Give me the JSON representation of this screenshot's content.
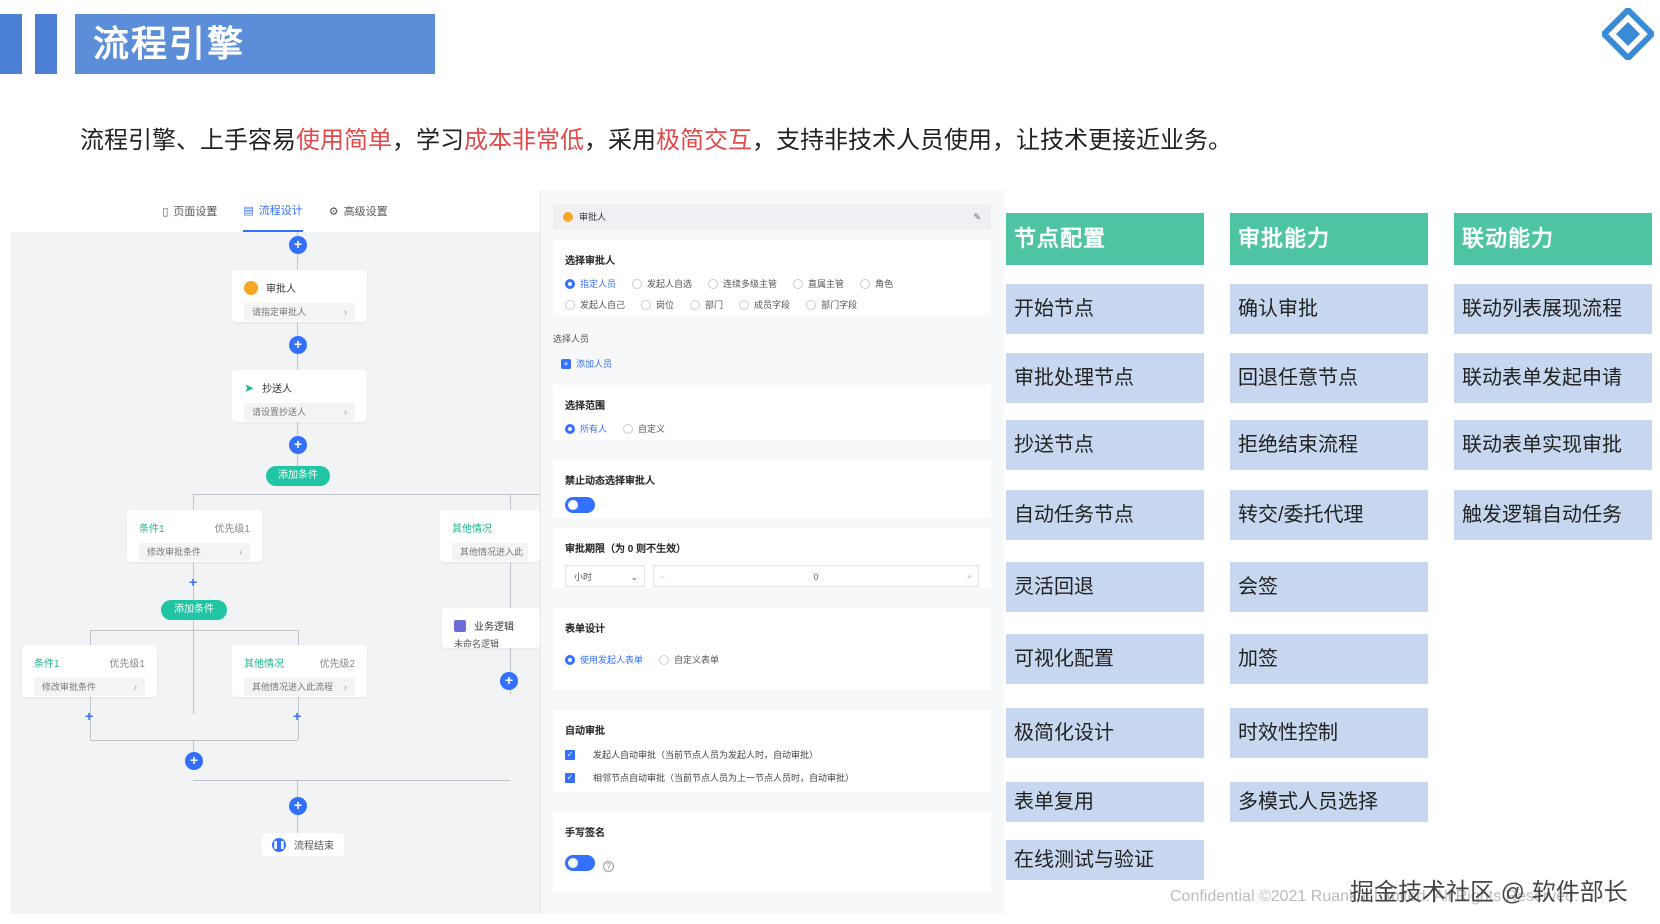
{
  "header": {
    "title": "流程引擎"
  },
  "subtitle": {
    "p1": "流程引擎、上手容易",
    "h1": "使用简单",
    "p2": "，学习",
    "h2": "成本非常低",
    "p3": "，采用",
    "h3": "极简交互",
    "p4": "，支持非技术人员使用，让技术更接近业务。"
  },
  "flow": {
    "tabs": [
      "页面设置",
      "流程设计",
      "高级设置"
    ],
    "approver": {
      "title": "审批人",
      "body": "请指定审批人"
    },
    "cc": {
      "title": "抄送人",
      "body": "请设置抄送人"
    },
    "add_condition": "添加条件",
    "cond1": {
      "name": "条件1",
      "priority": "优先级1",
      "body": "修改审批条件"
    },
    "other1": {
      "name": "其他情况",
      "body": "其他情况进入此"
    },
    "cond_a": {
      "name": "条件1",
      "priority": "优先级1",
      "body": "修改审批条件"
    },
    "other2": {
      "name": "其他情况",
      "priority": "优先级2",
      "body": "其他情况进入此流程"
    },
    "biz": {
      "title": "业务逻辑",
      "body": "未命名逻辑"
    },
    "end": "流程结束"
  },
  "config": {
    "top_title": "审批人",
    "select_approver": {
      "title": "选择审批人",
      "options": [
        "指定人员",
        "发起人自选",
        "连续多级主管",
        "直属主管",
        "角色",
        "发起人自己",
        "岗位",
        "部门",
        "成员字段",
        "部门字段"
      ],
      "selected": "指定人员"
    },
    "select_person_label": "选择人员",
    "add_person": "添加人员",
    "scope": {
      "title": "选择范围",
      "options": [
        "所有人",
        "自定义"
      ],
      "selected": "所有人"
    },
    "forbid_dynamic": {
      "title": "禁止动态选择审批人"
    },
    "deadline": {
      "title": "审批期限（为 0 则不生效）",
      "unit": "小时",
      "value": "0"
    },
    "form_design": {
      "title": "表单设计",
      "options": [
        "使用发起人表单",
        "自定义表单"
      ],
      "selected": "使用发起人表单"
    },
    "auto_approve": {
      "title": "自动审批",
      "items": [
        "发起人自动审批（当前节点人员为发起人时，自动审批）",
        "相邻节点自动审批（当前节点人员为上一节点人员时，自动审批）"
      ]
    },
    "signature": {
      "title": "手写签名"
    }
  },
  "features": {
    "node_config": {
      "title": "节点配置",
      "items": [
        "开始节点",
        "审批处理节点",
        "抄送节点",
        "自动任务节点",
        "灵活回退",
        "可视化配置",
        "极简化设计",
        "表单复用",
        "在线测试与验证"
      ]
    },
    "approval": {
      "title": "审批能力",
      "items": [
        "确认审批",
        "回退任意节点",
        "拒绝结束流程",
        "转交/委托代理",
        "会签",
        "加签",
        "时效性控制",
        "多模式人员选择"
      ]
    },
    "linkage": {
      "title": "联动能力",
      "items": [
        "联动列表展现流程",
        "联动表单发起申请",
        "联动表单实现审批",
        "触发逻辑自动任务"
      ]
    }
  },
  "footer": "Confidential ©2021 Ruankui Limited. All Rights Reserved.",
  "watermark": "掘金技术社区 @ 软件部长",
  "colors": {
    "accent": "#3370ff",
    "teal": "#4ec4a3",
    "cell": "#c6d7ef",
    "header": "#5b8dd9",
    "highlight": "#e04a4a"
  }
}
